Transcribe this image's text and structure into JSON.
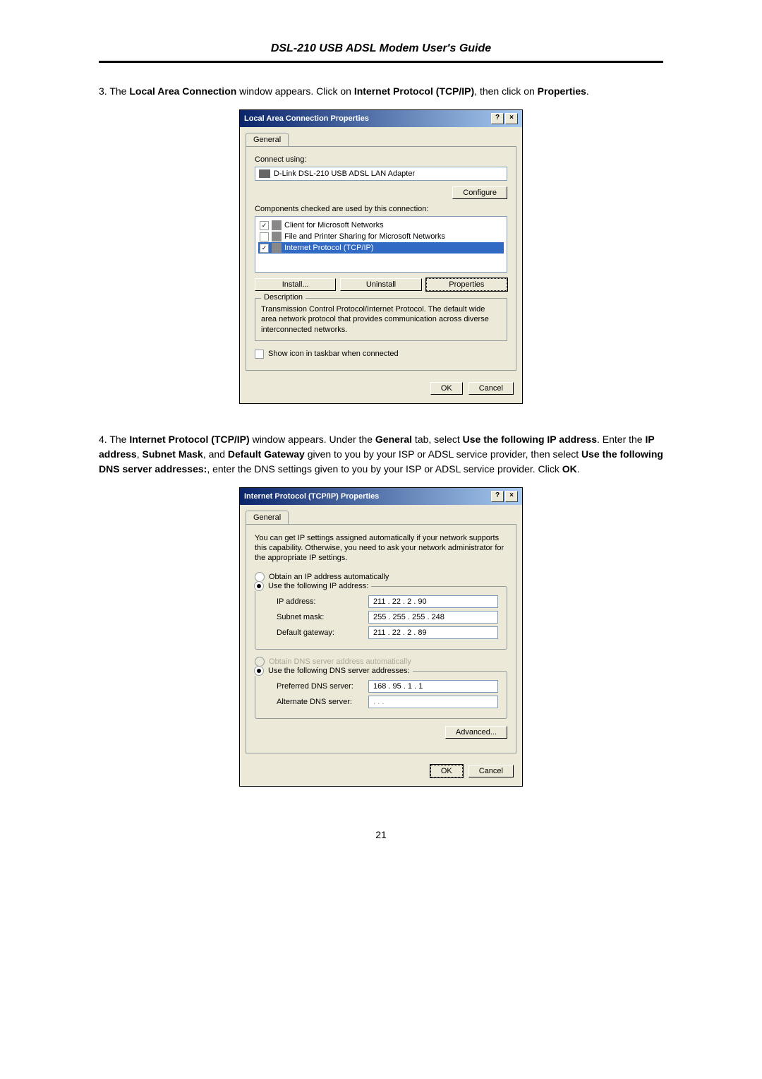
{
  "header": "DSL-210 USB ADSL Modem User's Guide",
  "step3": {
    "num": "3.",
    "text_before": "The ",
    "bold1": "Local Area Connection",
    "text_mid1": " window appears. Click on ",
    "bold2": "Internet Protocol (TCP/IP)",
    "text_mid2": ", then click on ",
    "bold3": "Properties",
    "text_after": "."
  },
  "dialog1": {
    "title": "Local Area Connection Properties",
    "help": "?",
    "close": "×",
    "tab": "General",
    "connect_using": "Connect using:",
    "adapter": "D-Link DSL-210 USB ADSL LAN Adapter",
    "configure": "Configure",
    "components_label": "Components checked are used by this connection:",
    "items": [
      {
        "checked": true,
        "label": "Client for Microsoft Networks",
        "selected": false
      },
      {
        "checked": false,
        "label": "File and Printer Sharing for Microsoft Networks",
        "selected": false
      },
      {
        "checked": true,
        "label": "Internet Protocol (TCP/IP)",
        "selected": true
      }
    ],
    "install": "Install...",
    "uninstall": "Uninstall",
    "properties": "Properties",
    "desc_title": "Description",
    "desc_text": "Transmission Control Protocol/Internet Protocol. The default wide area network protocol that provides communication across diverse interconnected networks.",
    "show_icon": "Show icon in taskbar when connected",
    "ok": "OK",
    "cancel": "Cancel"
  },
  "step4": {
    "num": "4.",
    "t1": "The ",
    "b1": "Internet Protocol (TCP/IP)",
    "t2": " window appears. Under the ",
    "b2": "General",
    "t3": " tab, select ",
    "b3": "Use the following IP address",
    "t4": ". Enter the ",
    "b4": "IP address",
    "t5": ", ",
    "b5": "Subnet Mask",
    "t6": ", and ",
    "b6": "Default Gateway",
    "t7": " given to you by your ISP or ADSL service provider, then select ",
    "b7": "Use the following DNS server addresses:",
    "t8": ", enter the DNS settings given to you by your ISP or ADSL service provider. Click ",
    "b8": "OK",
    "t9": "."
  },
  "dialog2": {
    "title": "Internet Protocol (TCP/IP) Properties",
    "help": "?",
    "close": "×",
    "tab": "General",
    "intro": "You can get IP settings assigned automatically if your network supports this capability. Otherwise, you need to ask your network administrator for the appropriate IP settings.",
    "obtain_ip": "Obtain an IP address automatically",
    "use_ip": "Use the following IP address:",
    "ip_label": "IP address:",
    "ip_val": "211 . 22 . 2 . 90",
    "subnet_label": "Subnet mask:",
    "subnet_val": "255 . 255 . 255 . 248",
    "gateway_label": "Default gateway:",
    "gateway_val": "211 . 22 . 2 . 89",
    "obtain_dns": "Obtain DNS server address automatically",
    "use_dns": "Use the following DNS server addresses:",
    "pref_dns_label": "Preferred DNS server:",
    "pref_dns_val": "168 . 95 . 1 . 1",
    "alt_dns_label": "Alternate DNS server:",
    "alt_dns_val": ".       .       .",
    "advanced": "Advanced...",
    "ok": "OK",
    "cancel": "Cancel"
  },
  "page_num": "21"
}
